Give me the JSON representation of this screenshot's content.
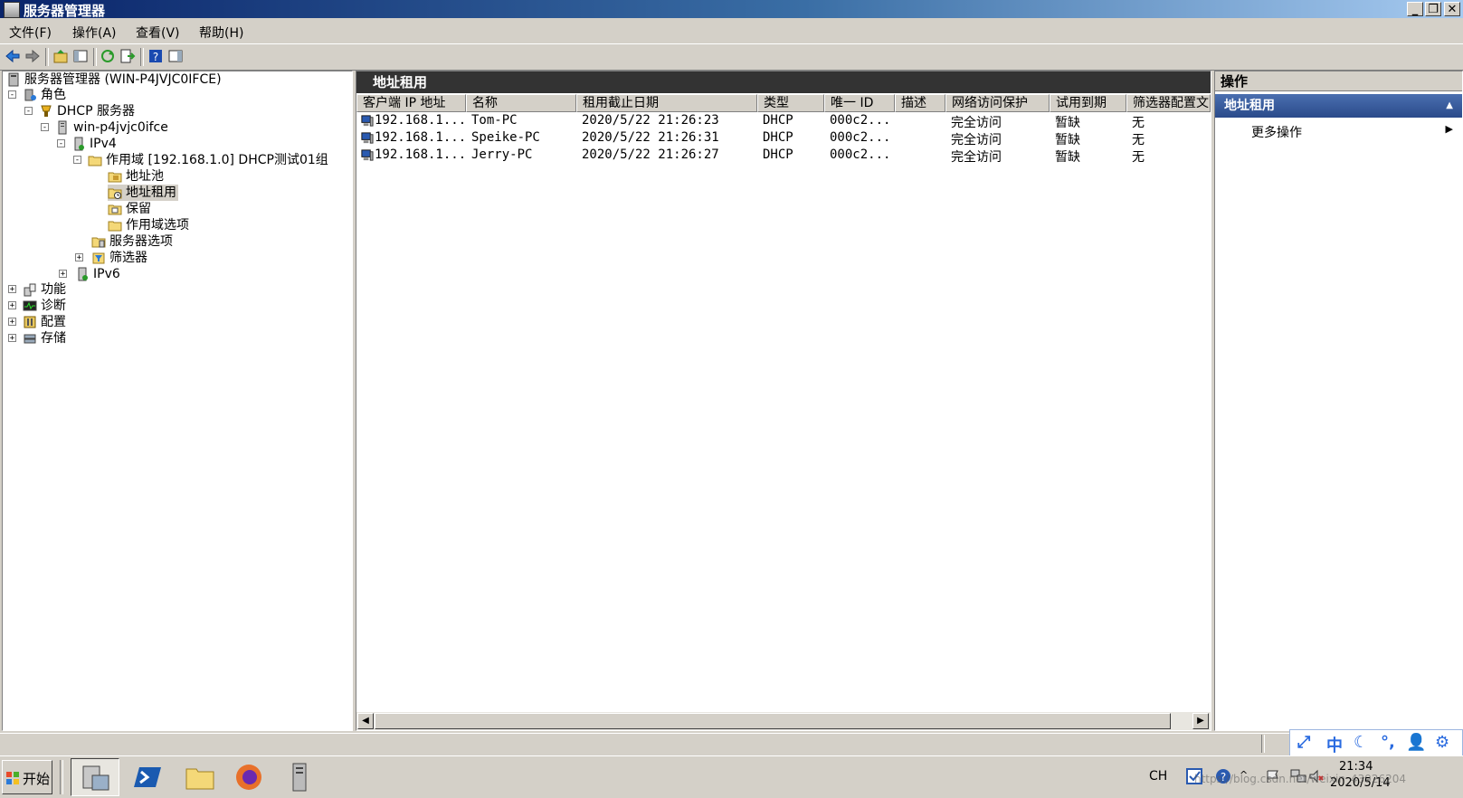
{
  "window": {
    "title": "服务器管理器",
    "buttons": {
      "minimize": "_",
      "restore": "❐",
      "close": "✕"
    }
  },
  "menu": [
    "文件(F)",
    "操作(A)",
    "查看(V)",
    "帮助(H)"
  ],
  "tree": {
    "root": "服务器管理器 (WIN-P4JVJC0IFCE)",
    "roles": "角色",
    "dhcp": "DHCP 服务器",
    "host": "win-p4jvjc0ifce",
    "ipv4": "IPv4",
    "scope": "作用域 [192.168.1.0] DHCP测试01组",
    "pool": "地址池",
    "leases": "地址租用",
    "reservations": "保留",
    "scope_options": "作用域选项",
    "server_options": "服务器选项",
    "filters": "筛选器",
    "ipv6": "IPv6",
    "features": "功能",
    "diagnostics": "诊断",
    "configuration": "配置",
    "storage": "存储"
  },
  "center": {
    "title": "地址租用",
    "columns": [
      "客户端 IP 地址",
      "名称",
      "租用截止日期",
      "类型",
      "唯一 ID",
      "描述",
      "网络访问保护",
      "试用到期",
      "筛选器配置文"
    ],
    "rows": [
      [
        "192.168.1...",
        "Tom-PC",
        "2020/5/22 21:26:23",
        "DHCP",
        "000c2...",
        "",
        "完全访问",
        "暂缺",
        "无"
      ],
      [
        "192.168.1...",
        "Speike-PC",
        "2020/5/22 21:26:31",
        "DHCP",
        "000c2...",
        "",
        "完全访问",
        "暂缺",
        "无"
      ],
      [
        "192.168.1...",
        "Jerry-PC",
        "2020/5/22 21:26:27",
        "DHCP",
        "000c2...",
        "",
        "完全访问",
        "暂缺",
        "无"
      ]
    ]
  },
  "actions": {
    "title": "操作",
    "section": "地址租用",
    "more": "更多操作"
  },
  "ime": [
    "⤢",
    "中",
    "☾",
    "°,",
    "👤",
    "⚙"
  ],
  "taskbar": {
    "start": "开始",
    "lang": "CH",
    "time": "21:34",
    "date": "2020/5/14",
    "watermark": "https://blog.csdn.net/weixin_43926204"
  },
  "colors": {
    "accent": "#2a4a8a",
    "title_bar": "#0a246a"
  }
}
